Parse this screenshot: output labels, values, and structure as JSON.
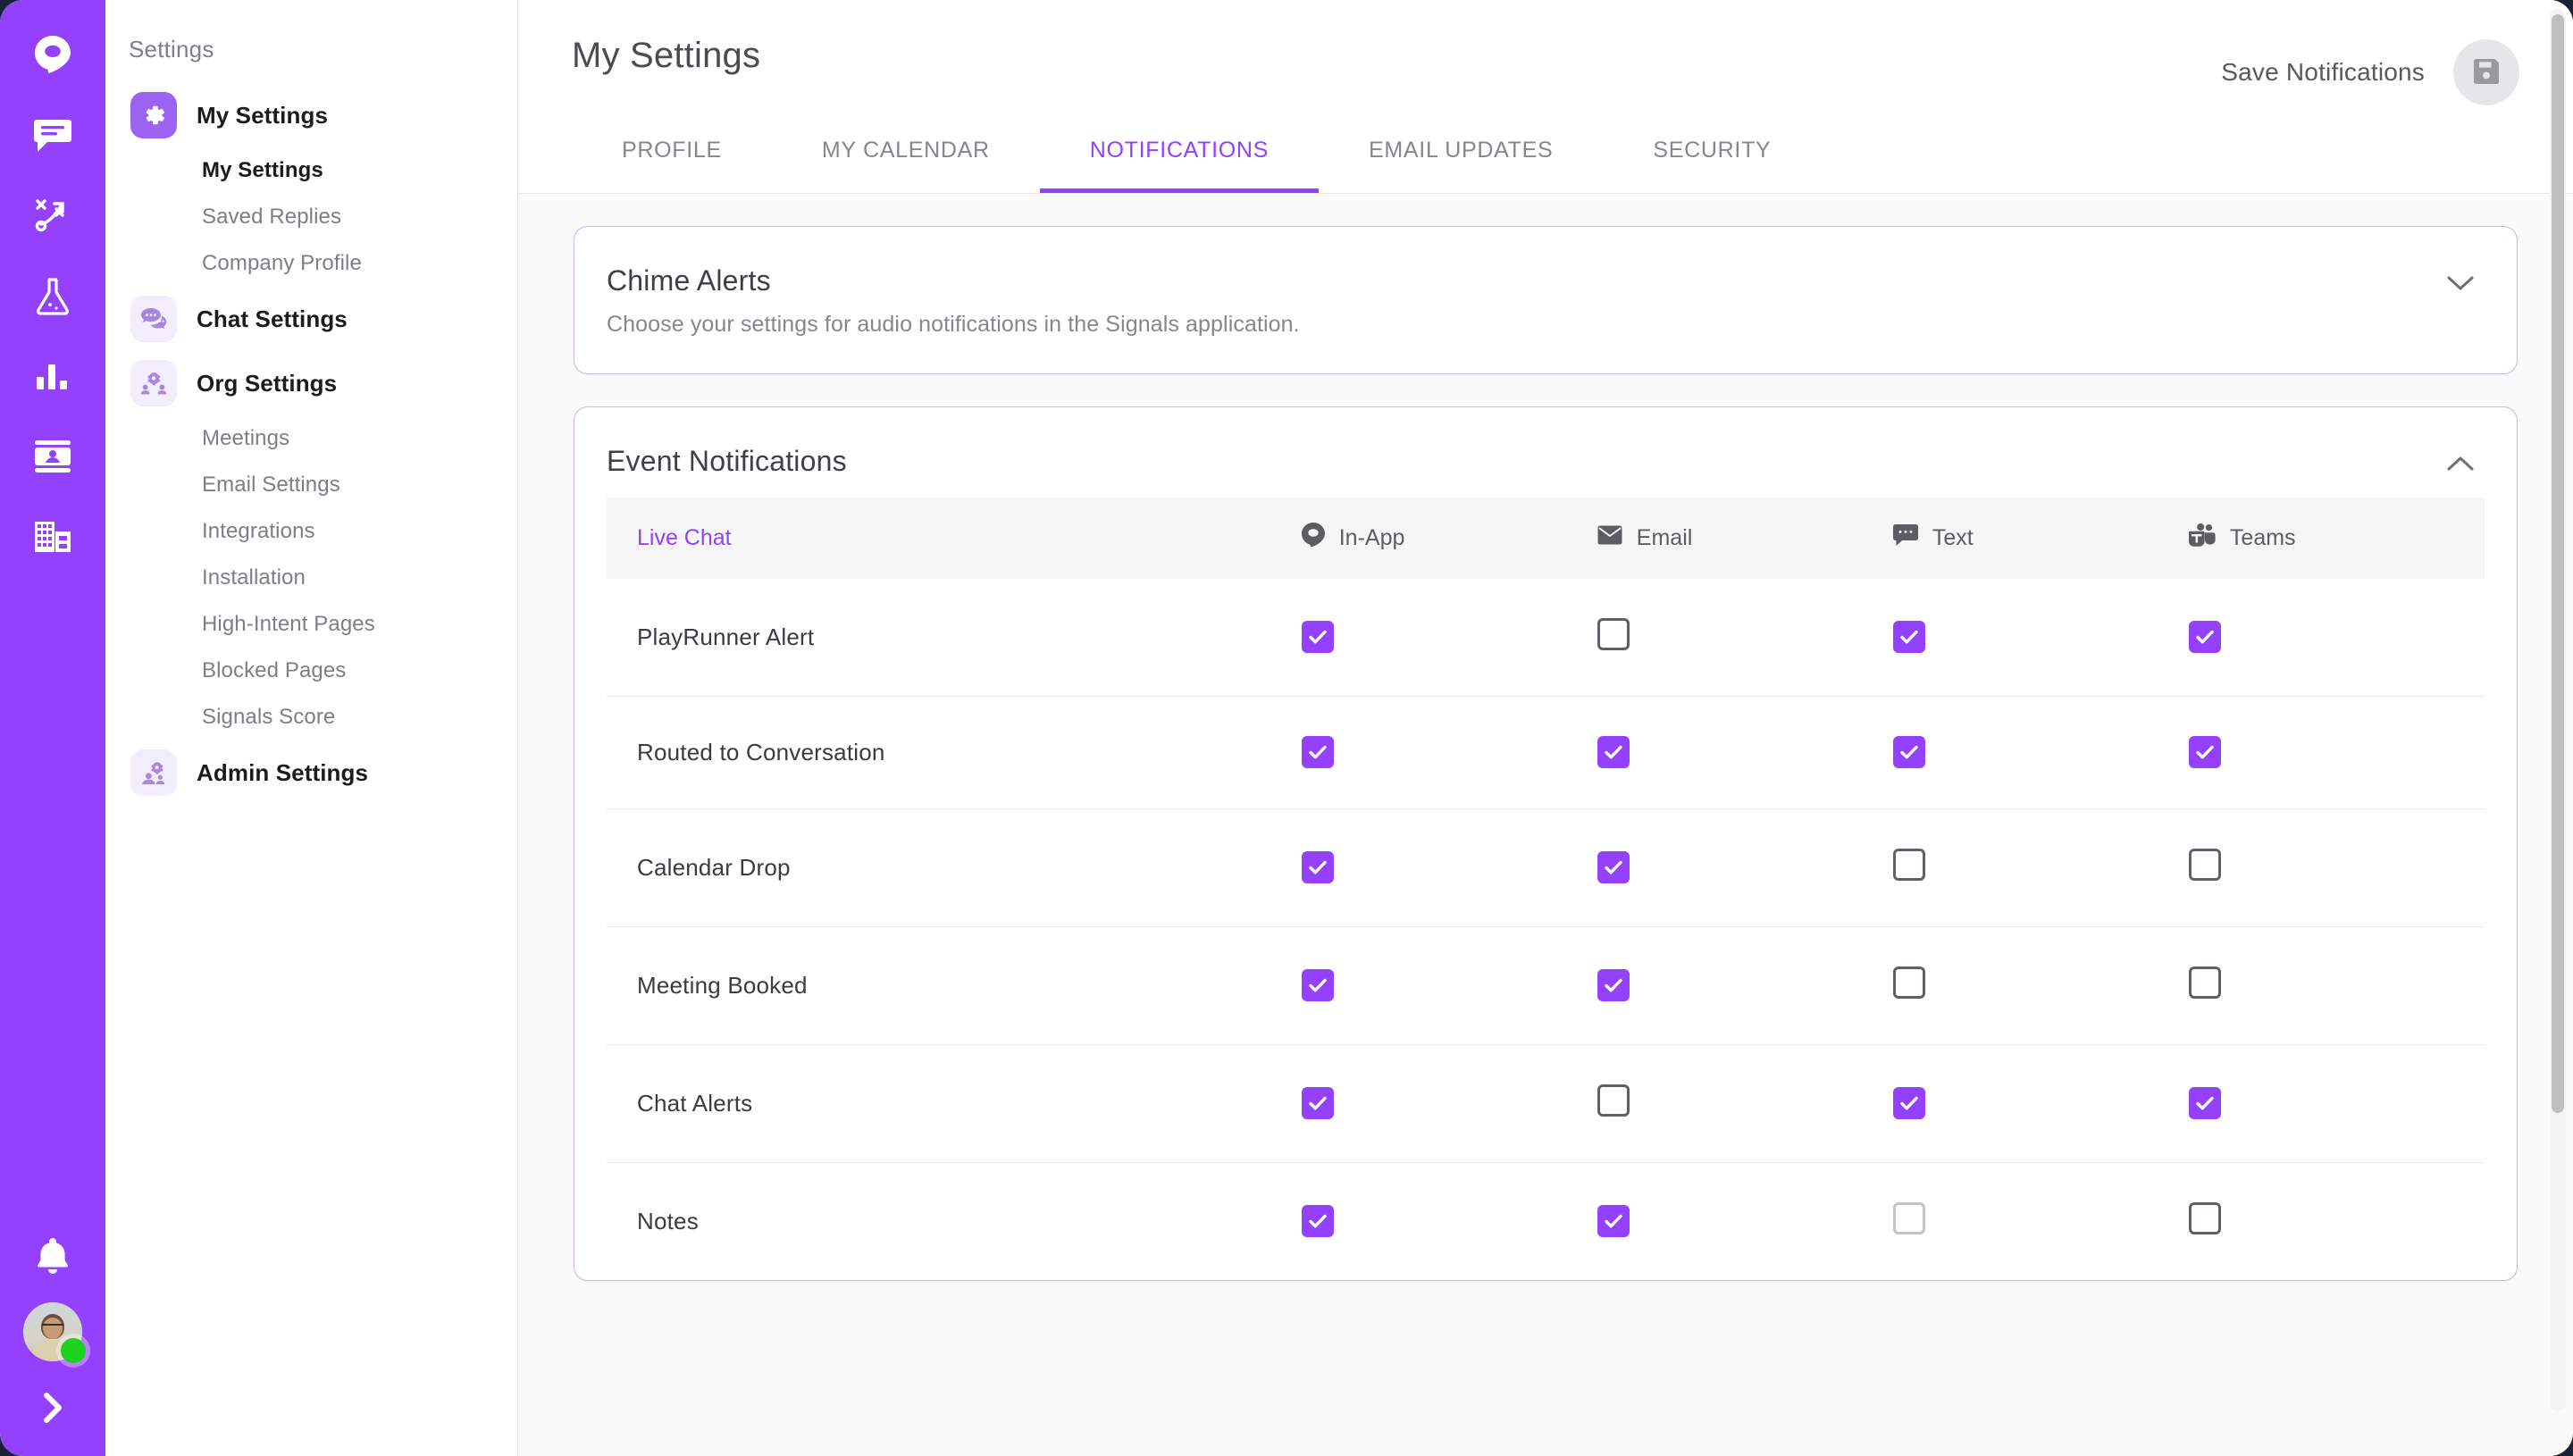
{
  "rail": {
    "icons": [
      {
        "name": "signals-logo-icon",
        "label": "Signals"
      },
      {
        "name": "chat-bubble-icon",
        "label": "Chat"
      },
      {
        "name": "playbooks-strategy-icon",
        "label": "Playbooks"
      },
      {
        "name": "experiments-flask-icon",
        "label": "Experiments"
      },
      {
        "name": "reports-bar-chart-icon",
        "label": "Reports"
      },
      {
        "name": "contacts-card-icon",
        "label": "Contacts"
      },
      {
        "name": "accounts-building-icon",
        "label": "Accounts"
      }
    ],
    "bell_label": "Notifications",
    "avatar_status": "online",
    "expand_label": "Expand navigation"
  },
  "sidebar": {
    "title": "Settings",
    "groups": [
      {
        "label": "My Settings",
        "icon": "gear-icon",
        "active": true,
        "items": [
          {
            "label": "My Settings",
            "selected": true
          },
          {
            "label": "Saved Replies",
            "selected": false
          },
          {
            "label": "Company Profile",
            "selected": false
          }
        ]
      },
      {
        "label": "Chat Settings",
        "icon": "chat-bubbles-icon",
        "active": false,
        "items": []
      },
      {
        "label": "Org Settings",
        "icon": "org-gear-people-icon",
        "active": false,
        "items": [
          {
            "label": "Meetings",
            "selected": false
          },
          {
            "label": "Email Settings",
            "selected": false
          },
          {
            "label": "Integrations",
            "selected": false
          },
          {
            "label": "Installation",
            "selected": false
          },
          {
            "label": "High-Intent Pages",
            "selected": false
          },
          {
            "label": "Blocked Pages",
            "selected": false
          },
          {
            "label": "Signals Score",
            "selected": false
          }
        ]
      },
      {
        "label": "Admin Settings",
        "icon": "admin-people-gear-icon",
        "active": false,
        "items": []
      }
    ]
  },
  "header": {
    "title": "My Settings",
    "save_label": "Save Notifications",
    "save_icon": "floppy-save-icon",
    "tabs": [
      {
        "label": "PROFILE",
        "active": false
      },
      {
        "label": "MY CALENDAR",
        "active": false
      },
      {
        "label": "NOTIFICATIONS",
        "active": true
      },
      {
        "label": "EMAIL UPDATES",
        "active": false
      },
      {
        "label": "SECURITY",
        "active": false
      }
    ]
  },
  "chime_card": {
    "title": "Chime Alerts",
    "subtitle": "Choose your settings for audio notifications in the Signals application.",
    "collapsed": true,
    "chevron": "chevron-down-icon"
  },
  "event_card": {
    "title": "Event Notifications",
    "collapsed": false,
    "chevron": "chevron-up-icon",
    "table": {
      "columns": [
        {
          "label": "Live Chat",
          "icon": null
        },
        {
          "label": "In-App",
          "icon": "in-app-drop-icon"
        },
        {
          "label": "Email",
          "icon": "envelope-icon"
        },
        {
          "label": "Text",
          "icon": "sms-bubble-icon"
        },
        {
          "label": "Teams",
          "icon": "ms-teams-icon"
        }
      ],
      "rows": [
        {
          "name": "PlayRunner Alert",
          "states": [
            "on",
            "off",
            "on",
            "on"
          ]
        },
        {
          "name": "Routed to Conversation",
          "states": [
            "on",
            "on",
            "on",
            "on"
          ]
        },
        {
          "name": "Calendar Drop",
          "states": [
            "on",
            "on",
            "off",
            "off"
          ]
        },
        {
          "name": "Meeting Booked",
          "states": [
            "on",
            "on",
            "off",
            "off"
          ]
        },
        {
          "name": "Chat Alerts",
          "states": [
            "on",
            "off",
            "on",
            "on"
          ]
        },
        {
          "name": "Notes",
          "states": [
            "on",
            "on",
            "dim",
            "off"
          ]
        }
      ]
    }
  },
  "colors": {
    "brand_purple": "#9340FF",
    "rail_purple": "#9340FF",
    "card_border": "#cdb6f0",
    "muted_text": "#86868c",
    "status_green": "#1fd11f"
  }
}
